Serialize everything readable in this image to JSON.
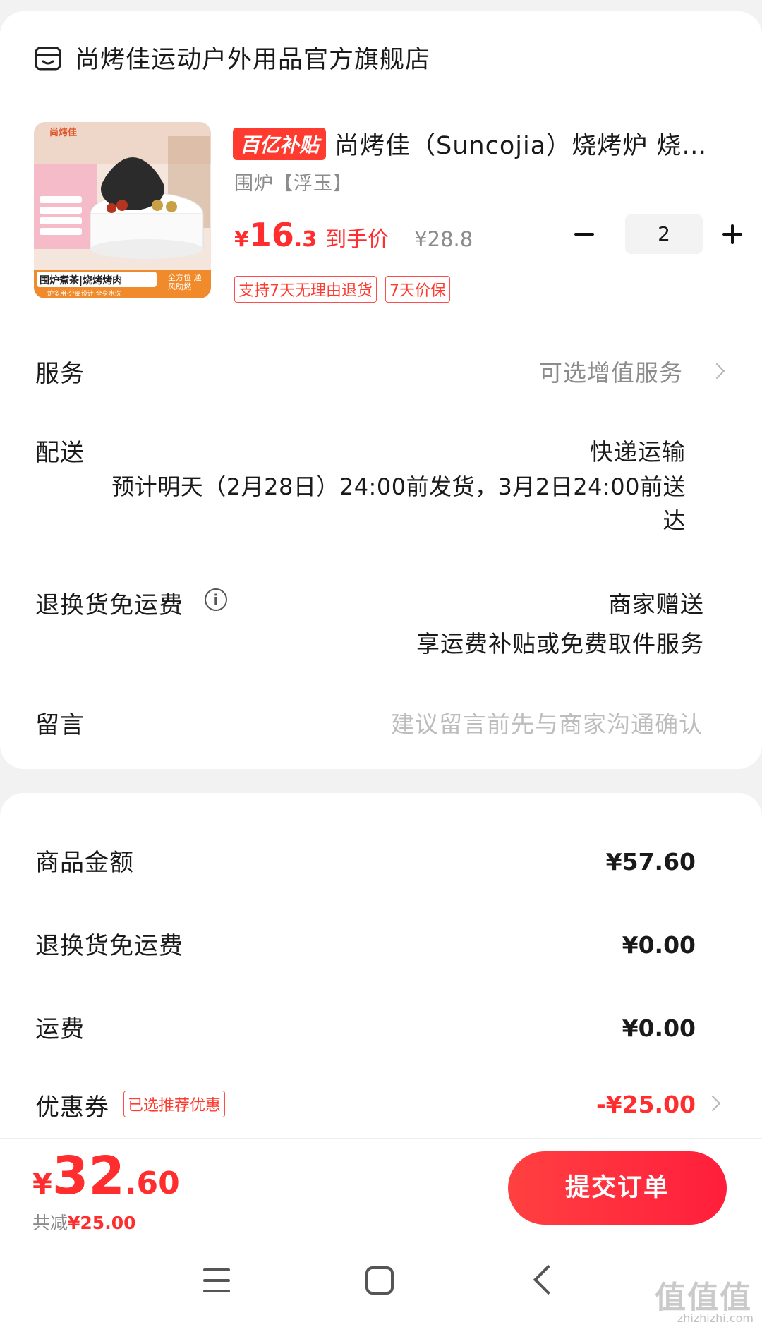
{
  "store": {
    "name": "尚烤佳运动户外用品官方旗舰店",
    "icon": "store-icon"
  },
  "product": {
    "subsidy_badge": "百亿补贴",
    "title": "尚烤佳（Suncojia）烧烤炉 烧烤…",
    "sku": "围炉【浮玉】",
    "price_currency": "¥",
    "price_int": "16",
    "price_dec": ".3",
    "price_label": "到手价",
    "original_price": "¥28.8",
    "quantity": "2",
    "tags": [
      "支持7天无理由退货",
      "7天价保"
    ],
    "thumb": {
      "brand": "尚烤佳",
      "caption": "围炉煮茶|烧烤烤肉",
      "sub": "一炉多用·分离设计·全身水洗",
      "badge": "全方位 通风助燃"
    }
  },
  "service": {
    "label": "服务",
    "value": "可选增值服务"
  },
  "delivery": {
    "label": "配送",
    "method": "快递运输",
    "detail_line1": "预计明天（2月28日）24:00前发货，3月2日24:00前送",
    "detail_line2": "达"
  },
  "return_shipping": {
    "label": "退换货免运费",
    "value": "商家赠送",
    "desc": "享运费补贴或免费取件服务"
  },
  "message": {
    "label": "留言",
    "placeholder": "建议留言前先与商家沟通确认"
  },
  "summary": {
    "goods_label": "商品金额",
    "goods_value": "¥57.60",
    "return_label": "退换货免运费",
    "return_value": "¥0.00",
    "shipping_label": "运费",
    "shipping_value": "¥0.00",
    "coupon_label": "优惠券",
    "coupon_tag": "已选推荐优惠",
    "coupon_value": "-¥25.00"
  },
  "footer": {
    "total_currency": "¥",
    "total_int": "32",
    "total_dec": ".60",
    "saved_label": "共减",
    "saved_value": "¥25.00",
    "submit_label": "提交订单"
  },
  "watermark": {
    "text": "值值值",
    "sub": "zhizhizhi.com"
  },
  "colors": {
    "accent": "#ff2d2d",
    "muted": "#8c8c8c"
  }
}
